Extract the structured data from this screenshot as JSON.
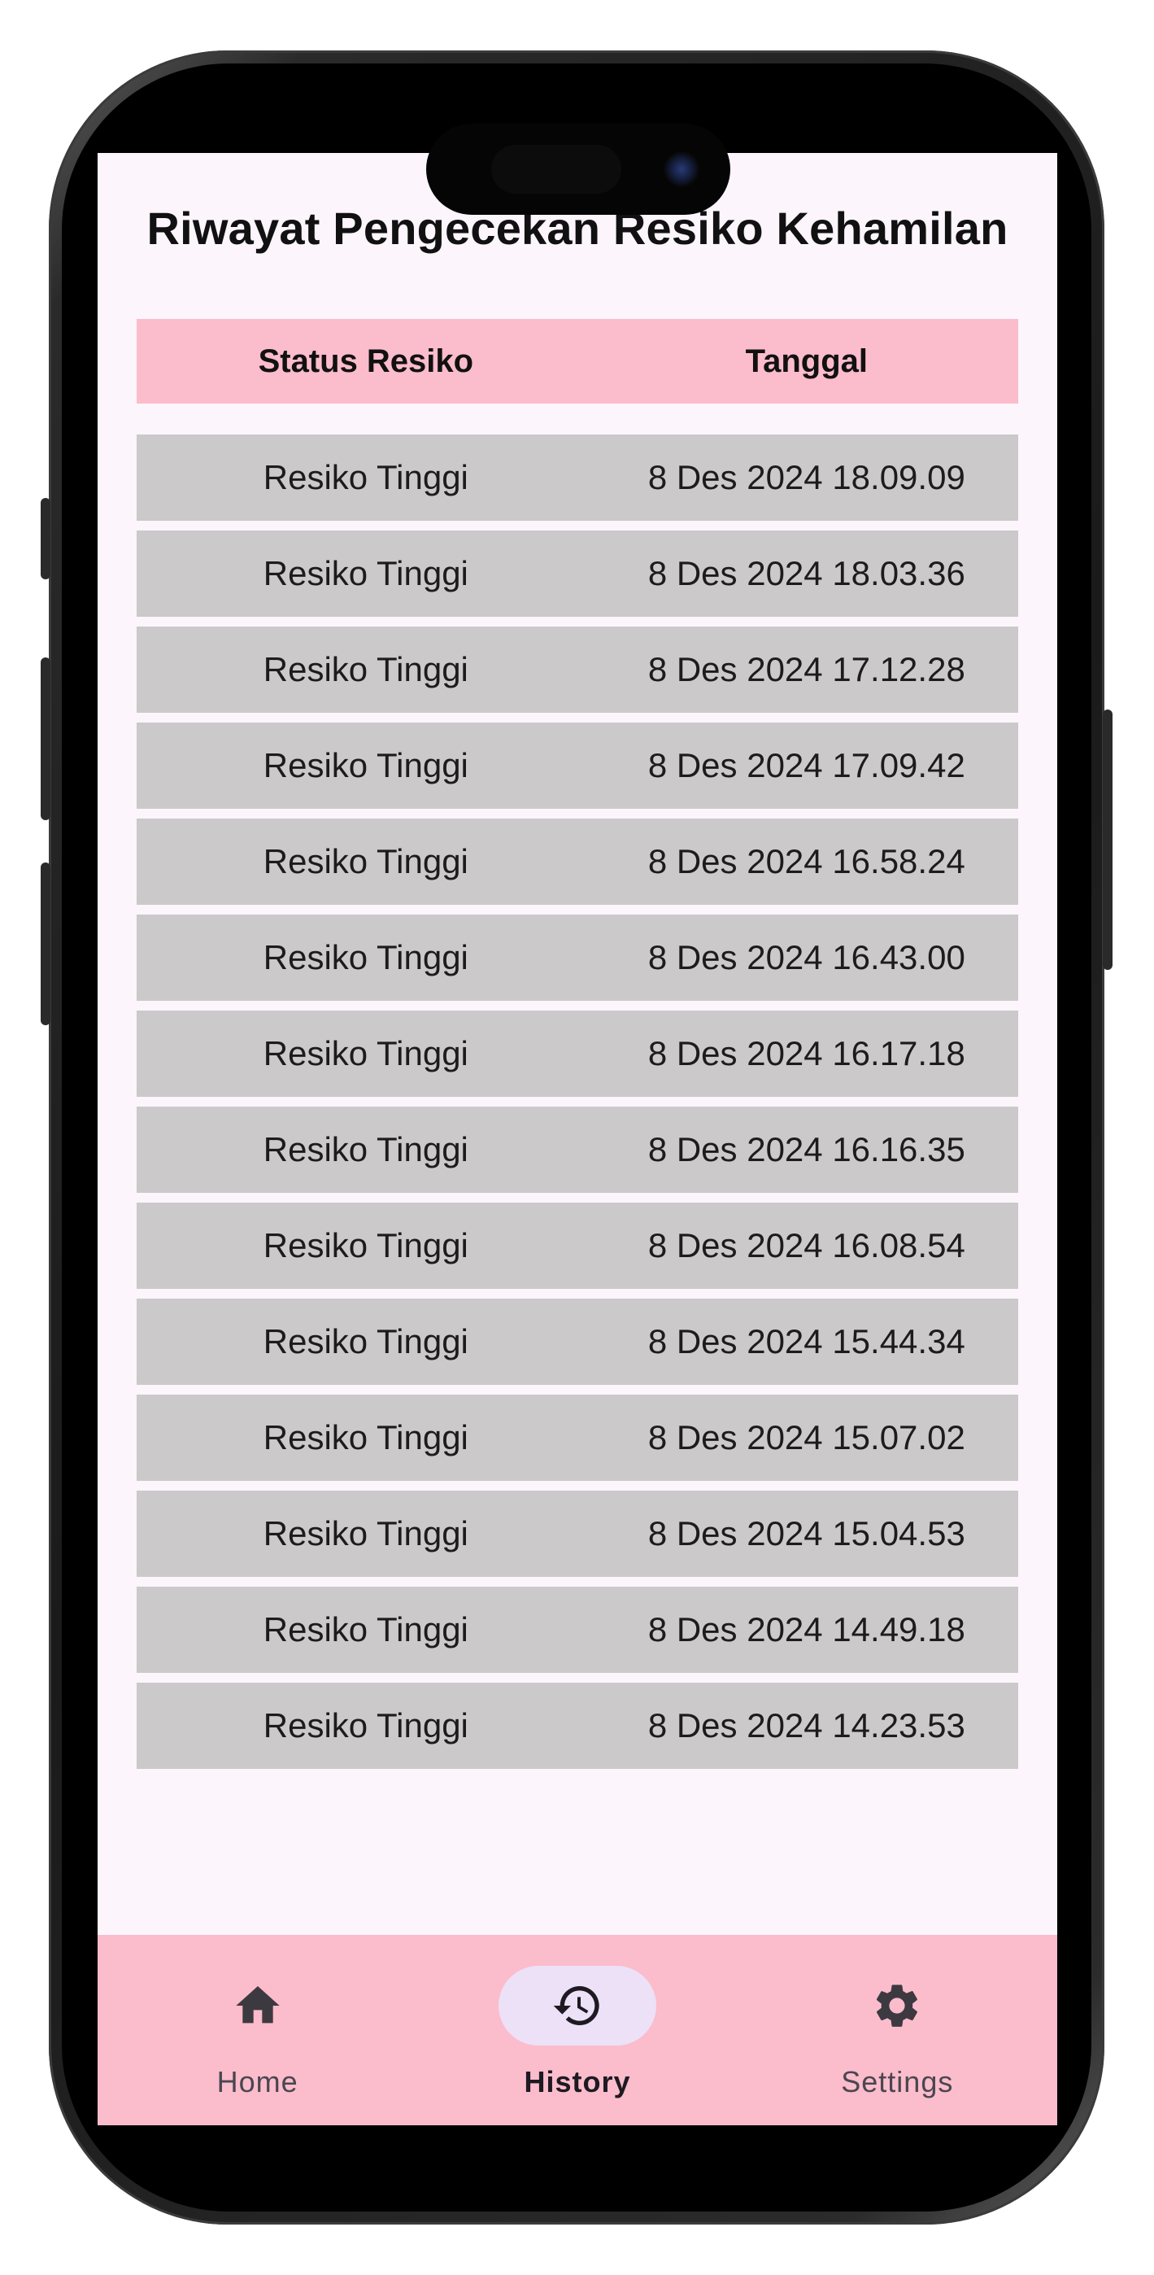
{
  "page": {
    "title": "Riwayat Pengecekan Resiko Kehamilan"
  },
  "table": {
    "headers": [
      "Status Resiko",
      "Tanggal"
    ],
    "rows": [
      [
        "Resiko Tinggi",
        "8 Des 2024 18.09.09"
      ],
      [
        "Resiko Tinggi",
        "8 Des 2024 18.03.36"
      ],
      [
        "Resiko Tinggi",
        "8 Des 2024 17.12.28"
      ],
      [
        "Resiko Tinggi",
        "8 Des 2024 17.09.42"
      ],
      [
        "Resiko Tinggi",
        "8 Des 2024 16.58.24"
      ],
      [
        "Resiko Tinggi",
        "8 Des 2024 16.43.00"
      ],
      [
        "Resiko Tinggi",
        "8 Des 2024 16.17.18"
      ],
      [
        "Resiko Tinggi",
        "8 Des 2024 16.16.35"
      ],
      [
        "Resiko Tinggi",
        "8 Des 2024 16.08.54"
      ],
      [
        "Resiko Tinggi",
        "8 Des 2024 15.44.34"
      ],
      [
        "Resiko Tinggi",
        "8 Des 2024 15.07.02"
      ],
      [
        "Resiko Tinggi",
        "8 Des 2024 15.04.53"
      ],
      [
        "Resiko Tinggi",
        "8 Des 2024 14.49.18"
      ],
      [
        "Resiko Tinggi",
        "8 Des 2024 14.23.53"
      ]
    ]
  },
  "nav": {
    "items": [
      {
        "label": "Home",
        "icon": "home-icon",
        "active": false
      },
      {
        "label": "History",
        "icon": "history-icon",
        "active": true
      },
      {
        "label": "Settings",
        "icon": "gear-icon",
        "active": false
      }
    ]
  },
  "colors": {
    "header_bg": "#fbbccc",
    "row_bg": "#cbc9c9",
    "screen_bg": "#fcf5fc",
    "nav_active_pill": "#ece1f7"
  }
}
